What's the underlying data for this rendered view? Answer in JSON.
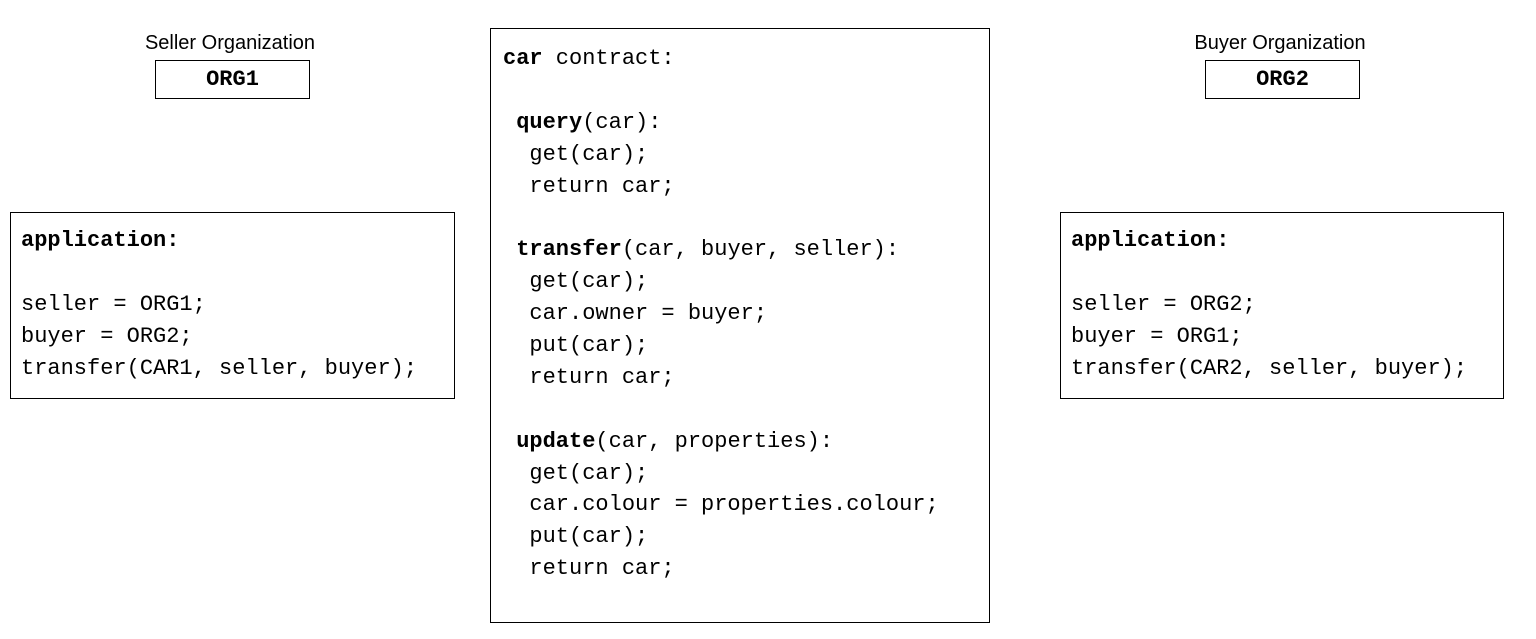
{
  "seller_org": {
    "label": "Seller Organization",
    "name": "ORG1"
  },
  "buyer_org": {
    "label": "Buyer Organization",
    "name": "ORG2"
  },
  "contract": {
    "header_kw": "car",
    "header_rest": " contract:",
    "query_kw": " query",
    "query_sig": "(car):",
    "query_l1": "  get(car);",
    "query_l2": "  return car;",
    "transfer_kw": " transfer",
    "transfer_sig": "(car, buyer, seller):",
    "transfer_l1": "  get(car);",
    "transfer_l2": "  car.owner = buyer;",
    "transfer_l3": "  put(car);",
    "transfer_l4": "  return car;",
    "update_kw": " update",
    "update_sig": "(car, properties):",
    "update_l1": "  get(car);",
    "update_l2": "  car.colour = properties.colour;",
    "update_l3": "  put(car);",
    "update_l4": "  return car;"
  },
  "app_left": {
    "title": "application:",
    "l1": "seller = ORG1;",
    "l2": "buyer = ORG2;",
    "l3": "transfer(CAR1, seller, buyer);"
  },
  "app_right": {
    "title": "application:",
    "l1": "seller = ORG2;",
    "l2": "buyer = ORG1;",
    "l3": "transfer(CAR2, seller, buyer);"
  }
}
